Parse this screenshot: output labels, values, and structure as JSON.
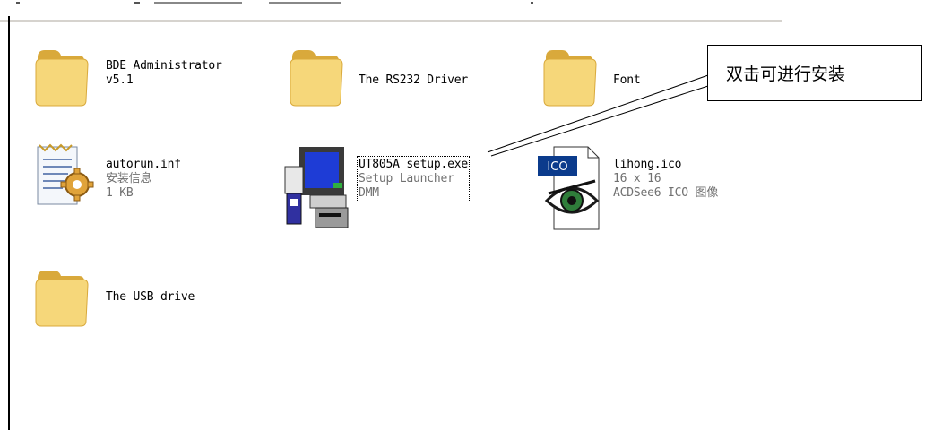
{
  "items": [
    {
      "name": "bde-administrator",
      "line1": "BDE Administrator",
      "line2": "v5.1"
    },
    {
      "name": "rs232-driver",
      "line1": "The RS232 Driver"
    },
    {
      "name": "font",
      "line1": "Font"
    },
    {
      "name": "autorun-inf",
      "line1": "autorun.inf",
      "line2": "安装信息",
      "line3": "1 KB"
    },
    {
      "name": "ut805a-setup",
      "line1": "UT805A setup.exe",
      "line2": "Setup Launcher",
      "line3": "DMM"
    },
    {
      "name": "lihong-ico",
      "line1": "lihong.ico",
      "line2": "16 x 16",
      "line3": "ACDSee6 ICO 图像",
      "badge": "ICO"
    },
    {
      "name": "usb-drive",
      "line1": "The USB drive"
    }
  ],
  "callout": {
    "text": "双击可进行安装"
  },
  "colors": {
    "folder": "#f6d77a",
    "folder_dark": "#d9a93b",
    "accent": "#0b3b8c"
  }
}
